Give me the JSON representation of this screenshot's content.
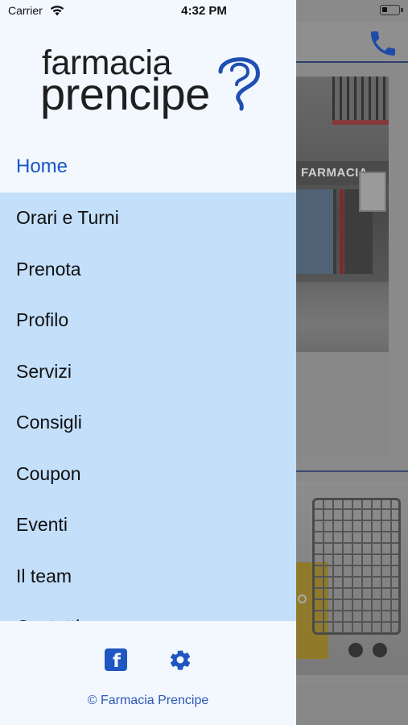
{
  "status_bar": {
    "carrier": "Carrier",
    "time": "4:32 PM"
  },
  "logo": {
    "line1": "farmacia",
    "line2": "prencipe"
  },
  "menu": {
    "home": "Home",
    "items": [
      {
        "label": "Orari e Turni"
      },
      {
        "label": "Prenota"
      },
      {
        "label": "Profilo"
      },
      {
        "label": "Servizi"
      },
      {
        "label": "Consigli"
      },
      {
        "label": "Coupon"
      },
      {
        "label": "Eventi"
      },
      {
        "label": "Il team"
      },
      {
        "label": "Contatti"
      }
    ]
  },
  "background": {
    "shop_sign": "FARMACIA"
  },
  "footer": {
    "copyright": "© Farmacia Prencipe"
  },
  "colors": {
    "accent": "#1a55c7",
    "menu_bg": "#c3dffa",
    "drawer_bg": "#f2f8fe"
  },
  "icons": {
    "facebook": "facebook-icon",
    "settings": "gear-icon",
    "phone": "phone-icon"
  }
}
